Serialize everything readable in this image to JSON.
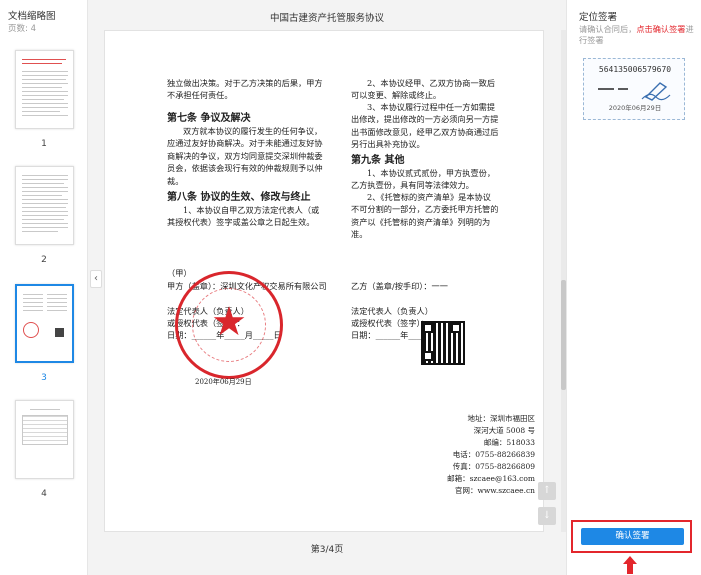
{
  "left": {
    "title": "文档缩略图",
    "page_count": "页数: 4",
    "thumbs": [
      {
        "num": "1"
      },
      {
        "num": "2"
      },
      {
        "num": "3"
      },
      {
        "num": "4"
      }
    ]
  },
  "center": {
    "doc_title": "中国古建资产托管服务协议",
    "page_indicator": "第3/4页",
    "collapse_glyph": "‹",
    "scroll_up_glyph": "↑",
    "scroll_down_glyph": "↓"
  },
  "page": {
    "left_col": {
      "p_top": "独立做出决策。对于乙方决策的后果，甲方不承担任何责任。",
      "h7": "第七条  争议及解决",
      "p7": "双方就本协议的履行发生的任何争议，应通过友好协商解决。对于未能通过友好协商解决的争议，双方均同意提交深圳仲裁委员会，依据该会现行有效的仲裁规则予以仲裁。",
      "h8": "第八条  协议的生效、修改与终止",
      "p8": "1、本协议自甲乙双方法定代表人（或其授权代表）签字或盖公章之日起生效。"
    },
    "right_col": {
      "p_a": "2、本协议经甲、乙双方协商一致后可以变更、解除或终止。",
      "p_b": "3、本协议履行过程中任一方如需提出修改，提出修改的一方必须向另一方提出书面修改意见，经甲乙双方协商通过后另行出具补充协议。",
      "h9": "第九条  其他",
      "p9a": "1、本协议贰式贰份，甲方执壹份，乙方执壹份，具有同等法律效力。",
      "p9b": "2、《托管标的资产清单》是本协议不可分割的一部分，乙方委托甲方托管的资产以《托管标的资产清单》列明的为准。"
    },
    "sign_left": {
      "l1": "（甲）",
      "l2": "甲方（盖章）：深圳文化产权交易所有限公司",
      "l3": "法定代表人（负责人）",
      "l4": "或授权代表（签字）：",
      "l5": "日期：______年_____月_____日",
      "date": "2020年06月29日"
    },
    "sign_right": {
      "l1": "乙方（盖章/按手印）：一一",
      "l2": "法定代表人（负责人）",
      "l3": "或授权代表（签字）：",
      "l4": "日期：______年_____月_____日"
    },
    "contact": {
      "addr": "地址：深圳市福田区",
      "addr2": "深河大道 5008 号",
      "post": "邮编：518033",
      "tel": "电话：0755-88266839",
      "fax": "传真：0755-88266809",
      "email": "邮箱：szcaee@163.com",
      "web": "官网：www.szcaee.cn"
    }
  },
  "right": {
    "title": "定位签署",
    "hint_pre": "请确认合同后，",
    "hint_red": "点击确认签署",
    "hint_post": "进行签署",
    "sig_number": "564135006579670",
    "sig_date": "2020年06月29日",
    "confirm_label": "确认签署"
  },
  "colors": {
    "accent": "#1e88e5",
    "highlight": "#e3262c",
    "stamp": "#d9262c"
  }
}
